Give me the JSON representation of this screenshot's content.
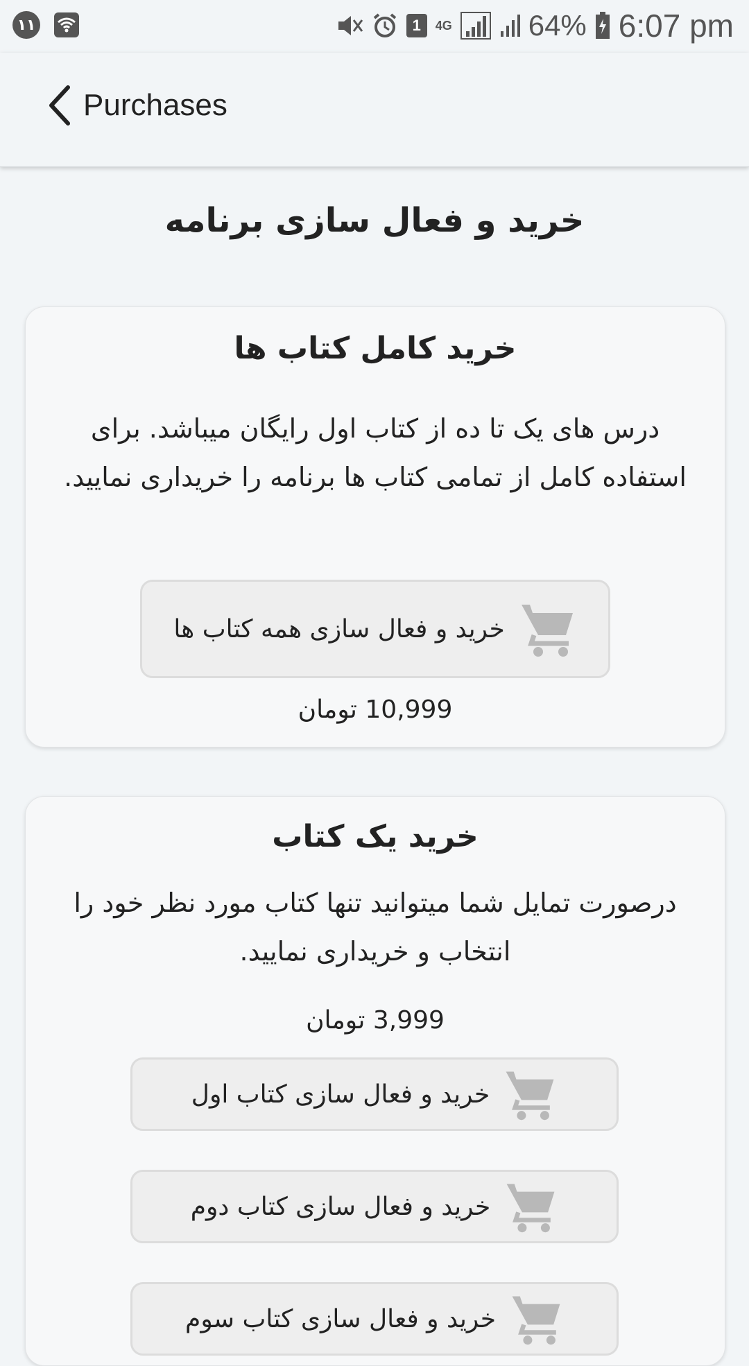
{
  "status_bar": {
    "notification_badge": "١١",
    "sim_slot": "1",
    "network": "4G",
    "battery": "64%",
    "time": "6:07 pm"
  },
  "app_bar": {
    "title": "Purchases"
  },
  "page": {
    "heading": "خرید و فعال سازی برنامه"
  },
  "full_purchase": {
    "title": "خرید کامل کتاب ها",
    "description": "درس های یک تا ده از کتاب اول رایگان میباشد. برای استفاده کامل از تمامی کتاب ها برنامه را خریداری نمایید.",
    "button_label": "خرید و فعال سازی همه کتاب ها",
    "price": "10,999 تومان"
  },
  "single_purchase": {
    "title": "خرید یک کتاب",
    "description": "درصورت تمایل شما میتوانید تنها کتاب مورد نظر خود را انتخاب و خریداری نمایید.",
    "price": "3,999 تومان",
    "buttons": [
      {
        "label": "خرید و فعال سازی کتاب اول"
      },
      {
        "label": "خرید و فعال سازی کتاب دوم"
      },
      {
        "label": "خرید و فعال سازی کتاب سوم"
      }
    ]
  },
  "colors": {
    "background": "#f2f5f7",
    "button_bg": "#eeeeee",
    "cart_icon": "#b8b8b8"
  },
  "icons": {
    "back": "chevron-left-icon",
    "cart": "cart-icon"
  }
}
